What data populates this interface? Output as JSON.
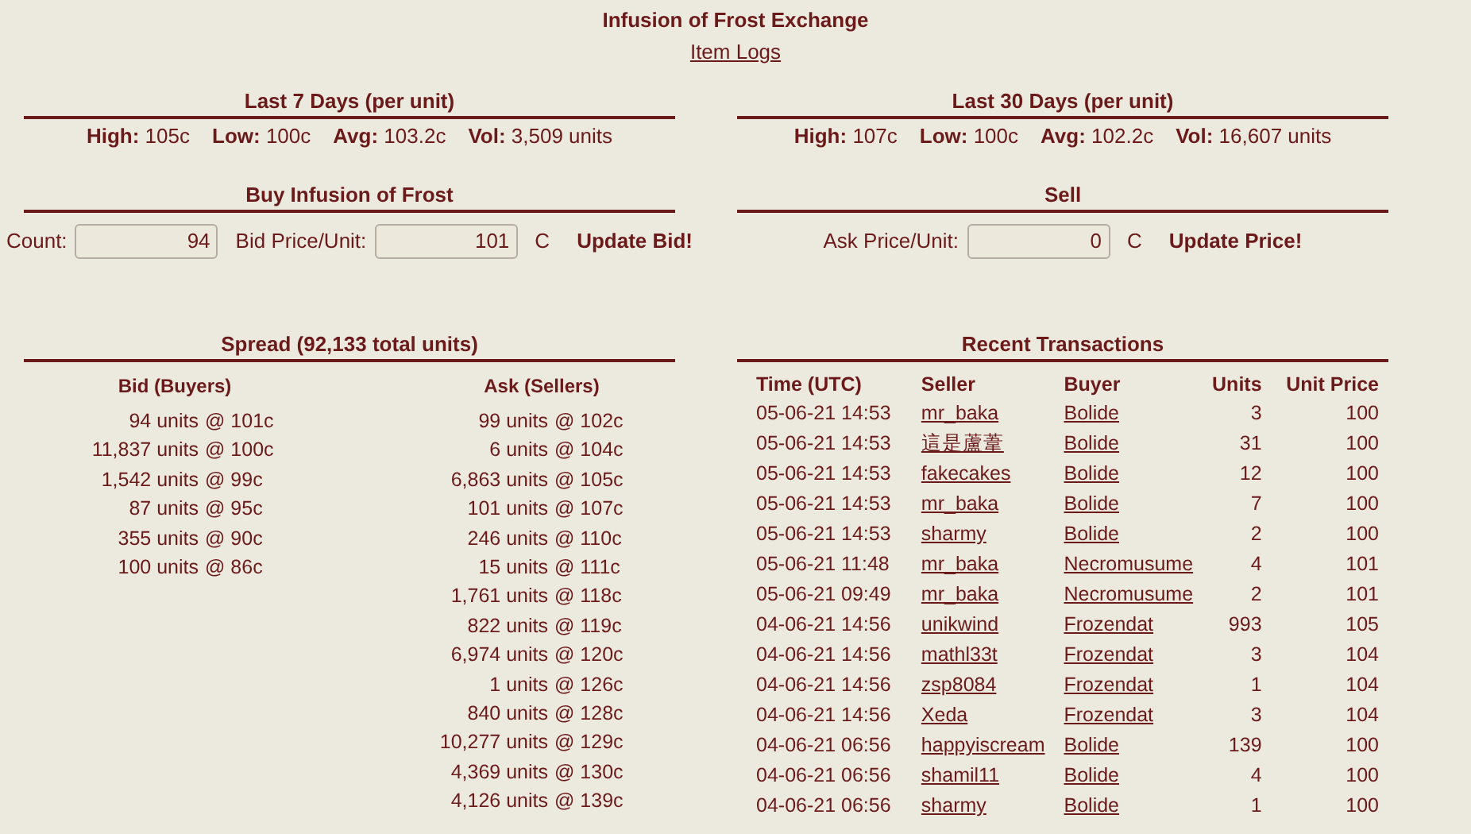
{
  "title": "Infusion of Frost Exchange",
  "item_logs_link": "Item Logs",
  "stats": [
    {
      "heading": "Last 7 Days (per unit)",
      "items": [
        {
          "label": "High:",
          "value": "105c"
        },
        {
          "label": "Low:",
          "value": "100c"
        },
        {
          "label": "Avg:",
          "value": "103.2c"
        },
        {
          "label": "Vol:",
          "value": "3,509 units"
        }
      ]
    },
    {
      "heading": "Last 30 Days (per unit)",
      "items": [
        {
          "label": "High:",
          "value": "107c"
        },
        {
          "label": "Low:",
          "value": "100c"
        },
        {
          "label": "Avg:",
          "value": "102.2c"
        },
        {
          "label": "Vol:",
          "value": "16,607 units"
        }
      ]
    }
  ],
  "buy": {
    "heading": "Buy Infusion of Frost",
    "fields": [
      {
        "label": "Count:",
        "value": "94"
      },
      {
        "label": "Bid Price/Unit:",
        "value": "101",
        "unit": "C"
      }
    ],
    "button": "Update Bid!"
  },
  "sell": {
    "heading": "Sell",
    "fields": [
      {
        "label": "Ask Price/Unit:",
        "value": "0",
        "unit": "C"
      }
    ],
    "button": "Update Price!"
  },
  "spread": {
    "heading": "Spread (92,133 total units)",
    "bids": {
      "heading": "Bid (Buyers)",
      "rows": [
        {
          "quantity": "94 units",
          "price": "@ 101c"
        },
        {
          "quantity": "11,837 units",
          "price": "@ 100c"
        },
        {
          "quantity": "1,542 units",
          "price": "@ 99c"
        },
        {
          "quantity": "87 units",
          "price": "@ 95c"
        },
        {
          "quantity": "355 units",
          "price": "@ 90c"
        },
        {
          "quantity": "100 units",
          "price": "@ 86c"
        }
      ]
    },
    "asks": {
      "heading": "Ask (Sellers)",
      "rows": [
        {
          "quantity": "99 units",
          "price": "@ 102c"
        },
        {
          "quantity": "6 units",
          "price": "@ 104c"
        },
        {
          "quantity": "6,863 units",
          "price": "@ 105c"
        },
        {
          "quantity": "101 units",
          "price": "@ 107c"
        },
        {
          "quantity": "246 units",
          "price": "@ 110c"
        },
        {
          "quantity": "15 units",
          "price": "@ 111c"
        },
        {
          "quantity": "1,761 units",
          "price": "@ 118c"
        },
        {
          "quantity": "822 units",
          "price": "@ 119c"
        },
        {
          "quantity": "6,974 units",
          "price": "@ 120c"
        },
        {
          "quantity": "1 units",
          "price": "@ 126c"
        },
        {
          "quantity": "840 units",
          "price": "@ 128c"
        },
        {
          "quantity": "10,277 units",
          "price": "@ 129c"
        },
        {
          "quantity": "4,369 units",
          "price": "@ 130c"
        },
        {
          "quantity": "4,126 units",
          "price": "@ 139c"
        }
      ]
    }
  },
  "transactions": {
    "heading": "Recent Transactions",
    "columns": [
      "Time (UTC)",
      "Seller",
      "Buyer",
      "Units",
      "Unit Price"
    ],
    "rows": [
      [
        "05-06-21 14:53",
        "mr_baka",
        "Bolide",
        "3",
        "100"
      ],
      [
        "05-06-21 14:53",
        "這是蘆葦",
        "Bolide",
        "31",
        "100"
      ],
      [
        "05-06-21 14:53",
        "fakecakes",
        "Bolide",
        "12",
        "100"
      ],
      [
        "05-06-21 14:53",
        "mr_baka",
        "Bolide",
        "7",
        "100"
      ],
      [
        "05-06-21 14:53",
        "sharmy",
        "Bolide",
        "2",
        "100"
      ],
      [
        "05-06-21 11:48",
        "mr_baka",
        "Necromusume",
        "4",
        "101"
      ],
      [
        "05-06-21 09:49",
        "mr_baka",
        "Necromusume",
        "2",
        "101"
      ],
      [
        "04-06-21 14:56",
        "unikwind",
        "Frozendat",
        "993",
        "105"
      ],
      [
        "04-06-21 14:56",
        "mathl33t",
        "Frozendat",
        "3",
        "104"
      ],
      [
        "04-06-21 14:56",
        "zsp8084",
        "Frozendat",
        "1",
        "104"
      ],
      [
        "04-06-21 14:56",
        "Xeda",
        "Frozendat",
        "3",
        "104"
      ],
      [
        "04-06-21 06:56",
        "happyiscream",
        "Bolide",
        "139",
        "100"
      ],
      [
        "04-06-21 06:56",
        "shamil11",
        "Bolide",
        "4",
        "100"
      ],
      [
        "04-06-21 06:56",
        "sharmy",
        "Bolide",
        "1",
        "100"
      ]
    ]
  }
}
